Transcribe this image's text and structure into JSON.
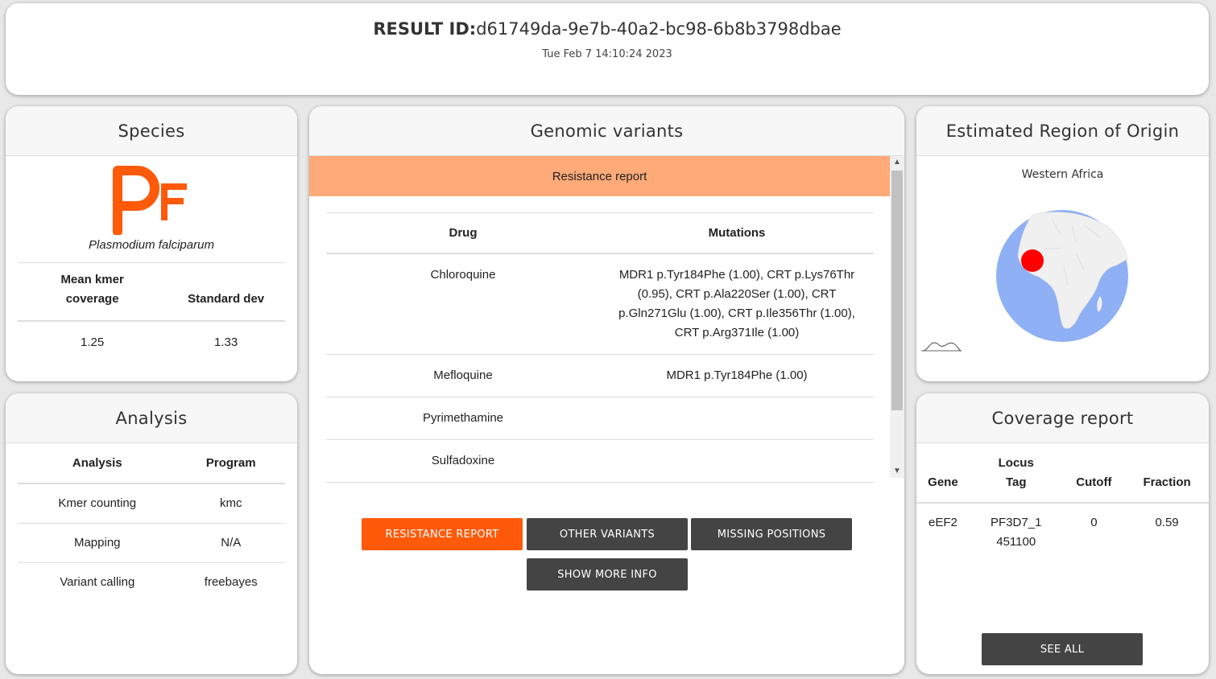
{
  "banner": {
    "result_label": "RESULT ID:",
    "result_id": "d61749da-9e7b-40a2-bc98-6b8b3798dbae",
    "date": "Tue Feb 7 14:10:24 2023"
  },
  "species": {
    "title": "Species",
    "logo_text": "PF",
    "name": "Plasmodium falciparum",
    "headers": [
      "Mean kmer coverage",
      "Standard dev"
    ],
    "values": [
      "1.25",
      "1.33"
    ]
  },
  "analysis": {
    "title": "Analysis",
    "headers": [
      "Analysis",
      "Program"
    ],
    "rows": [
      [
        "Kmer counting",
        "kmc"
      ],
      [
        "Mapping",
        "N/A"
      ],
      [
        "Variant calling",
        "freebayes"
      ]
    ]
  },
  "genomic": {
    "title": "Genomic variants",
    "report_header": "Resistance report",
    "headers": [
      "Drug",
      "Mutations"
    ],
    "rows": [
      [
        "Chloroquine",
        "MDR1 p.Tyr184Phe (1.00), CRT p.Lys76Thr (0.95), CRT p.Ala220Ser (1.00), CRT p.Gln271Glu (1.00), CRT p.Ile356Thr (1.00), CRT p.Arg371Ile (1.00)"
      ],
      [
        "Mefloquine",
        "MDR1 p.Tyr184Phe (1.00)"
      ],
      [
        "Pyrimethamine",
        ""
      ],
      [
        "Sulfadoxine",
        ""
      ]
    ],
    "buttons": {
      "resistance": "RESISTANCE REPORT",
      "other": "OTHER VARIANTS",
      "missing": "MISSING POSITIONS",
      "more": "SHOW MORE INFO"
    }
  },
  "region": {
    "title": "Estimated Region of Origin",
    "name": "Western Africa"
  },
  "coverage": {
    "title": "Coverage report",
    "headers": [
      "Gene",
      "Locus Tag",
      "Cutoff",
      "Fraction"
    ],
    "rows": [
      [
        "eEF2",
        "PF3D7_1451100",
        "0",
        "0.59"
      ]
    ],
    "see_all": "SEE ALL"
  },
  "colors": {
    "accent": "#ff5a0a",
    "report_header_bg": "#ffaa78",
    "button_dark": "#444444",
    "globe_ocean": "#8fb0f5",
    "globe_land": "#f0f0f0",
    "origin_marker": "#ff0000"
  }
}
